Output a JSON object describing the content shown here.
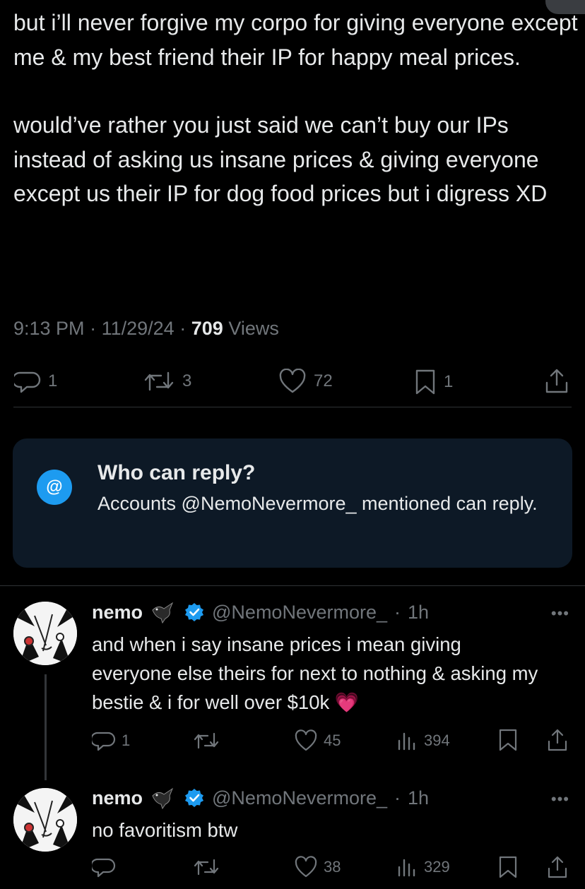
{
  "main_tweet": {
    "paragraphs": [
      "but i’ll never forgive my corpo for giving everyone except me & my best friend their IP for happy meal prices.",
      "would’ve rather you just said we can’t buy our IPs instead of asking us insane prices & giving everyone except us their IP for dog food prices but i digress XD"
    ],
    "time": "9:13 PM",
    "date": "11/29/24",
    "views_count": "709",
    "views_label": "Views",
    "actions": {
      "replies": "1",
      "reposts": "3",
      "likes": "72",
      "bookmarks": "1"
    }
  },
  "who_can_reply": {
    "icon": "@",
    "title": "Who can reply?",
    "description": "Accounts @NemoNevermore_ mentioned can reply."
  },
  "replies": [
    {
      "name": "nemo",
      "handle": "@NemoNevermore_",
      "time": "1h",
      "text": "and when i say insane prices i mean giving everyone else theirs for next to nothing & asking my bestie & i for well over $10k",
      "emoji": "💗",
      "actions": {
        "replies": "1",
        "reposts": "",
        "likes": "45",
        "views": "394"
      }
    },
    {
      "name": "nemo",
      "handle": "@NemoNevermore_",
      "time": "1h",
      "text": "no favoritism btw",
      "emoji": "",
      "actions": {
        "replies": "",
        "reposts": "",
        "likes": "38",
        "views": "329"
      }
    }
  ],
  "separator": "·",
  "more_label": "•••",
  "colors": {
    "background": "#000000",
    "text": "#e7e9ea",
    "muted": "#71767b",
    "accent": "#1d9bf0",
    "reply_box": "#0d1926",
    "divider": "#2f3336"
  }
}
